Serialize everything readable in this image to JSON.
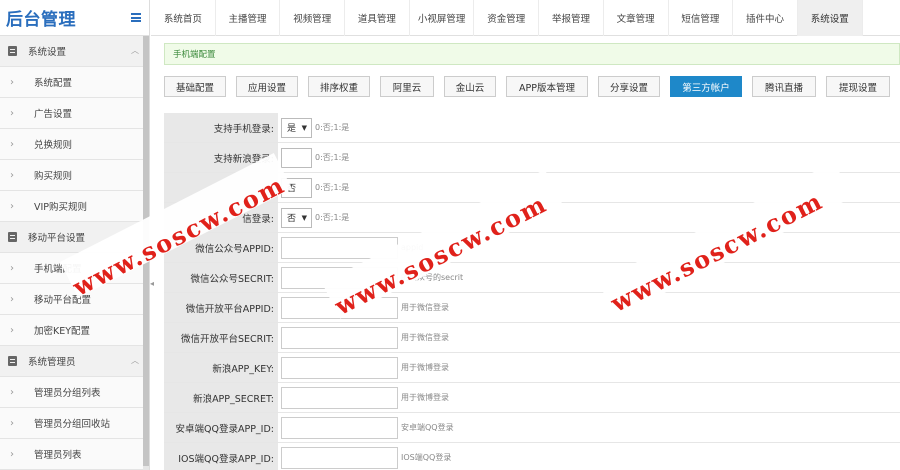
{
  "app": {
    "title": "后台管理"
  },
  "sidebar": {
    "items": [
      {
        "type": "group",
        "label": "系统设置",
        "icon": "doc-icon",
        "expanded": true
      },
      {
        "type": "sub",
        "label": "系统配置"
      },
      {
        "type": "sub",
        "label": "广告设置"
      },
      {
        "type": "sub",
        "label": "兑换规则"
      },
      {
        "type": "sub",
        "label": "购买规则"
      },
      {
        "type": "sub",
        "label": "VIP购买规则"
      },
      {
        "type": "group",
        "label": "移动平台设置",
        "icon": "doc-icon",
        "expanded": false
      },
      {
        "type": "sub",
        "label": "手机端配置"
      },
      {
        "type": "sub",
        "label": "移动平台配置"
      },
      {
        "type": "sub",
        "label": "加密KEY配置"
      },
      {
        "type": "group",
        "label": "系统管理员",
        "icon": "doc-icon",
        "expanded": true
      },
      {
        "type": "sub",
        "label": "管理员分组列表"
      },
      {
        "type": "sub",
        "label": "管理员分组回收站"
      },
      {
        "type": "sub",
        "label": "管理员列表"
      }
    ]
  },
  "topnav": {
    "tabs": [
      "系统首页",
      "主播管理",
      "视频管理",
      "道具管理",
      "小视屏管理",
      "资金管理",
      "举报管理",
      "文章管理",
      "短信管理",
      "插件中心",
      "系统设置"
    ],
    "active_index": 10
  },
  "notice": {
    "text": "手机端配置"
  },
  "settings_tabs": {
    "buttons": [
      "基础配置",
      "应用设置",
      "排序权重",
      "阿里云",
      "金山云",
      "APP版本管理",
      "分享设置",
      "第三方帐户",
      "腾讯直播",
      "提现设置"
    ],
    "active_index": 7
  },
  "form": {
    "rows": [
      {
        "label": "支持手机登录:",
        "kind": "select",
        "value": "是",
        "hint": "0:否;1:是"
      },
      {
        "label": "支持新浪登录:",
        "kind": "select",
        "value": "",
        "hint": "0:否;1:是"
      },
      {
        "label": "",
        "kind": "select",
        "value": "否",
        "hint": "0:否;1:是"
      },
      {
        "label": "信登录:",
        "kind": "select",
        "value": "否",
        "hint": "0:否;1:是"
      },
      {
        "label": "微信公众号APPID:",
        "kind": "input",
        "value": "",
        "hint": "appid"
      },
      {
        "label": "微信公众号SECRIT:",
        "kind": "input",
        "value": "",
        "hint": "的公众号的secrit"
      },
      {
        "label": "微信开放平台APPID:",
        "kind": "input",
        "value": "",
        "hint": "用于微信登录"
      },
      {
        "label": "微信开放平台SECRIT:",
        "kind": "input",
        "value": "",
        "hint": "用于微信登录"
      },
      {
        "label": "新浪APP_KEY:",
        "kind": "input",
        "value": "",
        "hint": "用于微博登录"
      },
      {
        "label": "新浪APP_SECRET:",
        "kind": "input",
        "value": "",
        "hint": "用于微博登录"
      },
      {
        "label": "安卓端QQ登录APP_ID:",
        "kind": "input",
        "value": "",
        "hint": "安卓端QQ登录"
      },
      {
        "label": "IOS端QQ登录APP_ID:",
        "kind": "input",
        "value": "",
        "hint": "IOS端QQ登录"
      }
    ]
  },
  "watermark": {
    "text": "www.soscw.com",
    "color": "#e0211a"
  }
}
